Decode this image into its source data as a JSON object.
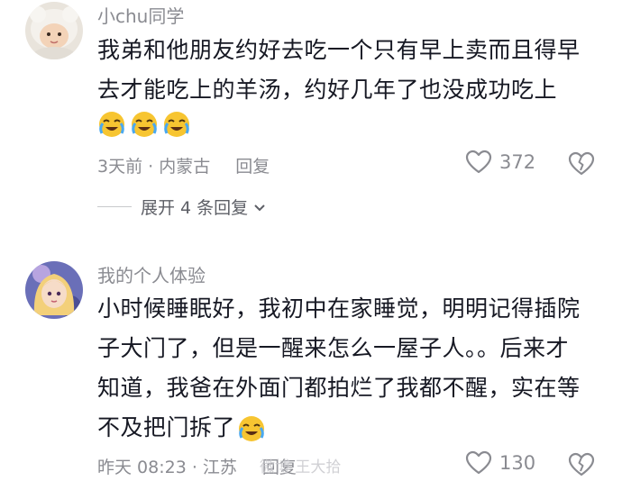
{
  "comments": [
    {
      "username": "小chu同学",
      "lines": [
        "我弟和他朋友约好去吃一个只有早上卖而且得早",
        "去才能吃上的羊汤，约好几年了也没成功吃上"
      ],
      "emoji_count": 3,
      "emoji_icon": "crying-laughing-emoji-icon",
      "time_location": "3天前 · 内蒙古",
      "reply_label": "回复",
      "like_count": "372",
      "expand_replies_label": "展开 4 条回复"
    },
    {
      "username": "我的个人体验",
      "lines": [
        "小时候睡眠好，我初中在家睡觉，明明记得插院",
        "子大门了，但是一醒来怎么一屋子人。。后来才",
        "知道，我爸在外面门都拍烂了我都不醒，实在等",
        "不及把门拆了"
      ],
      "emoji_icon": "crying-laughing-emoji-icon",
      "time_location": "昨天 08:23 · 江苏",
      "reply_label": "回复",
      "like_count": "130"
    }
  ],
  "watermark": "微博  王大拾",
  "colors": {
    "text_primary": "#161823",
    "text_secondary": "#8a8b91",
    "emoji_yellow": "#f7c531",
    "emoji_tear": "#4aa8f0"
  }
}
